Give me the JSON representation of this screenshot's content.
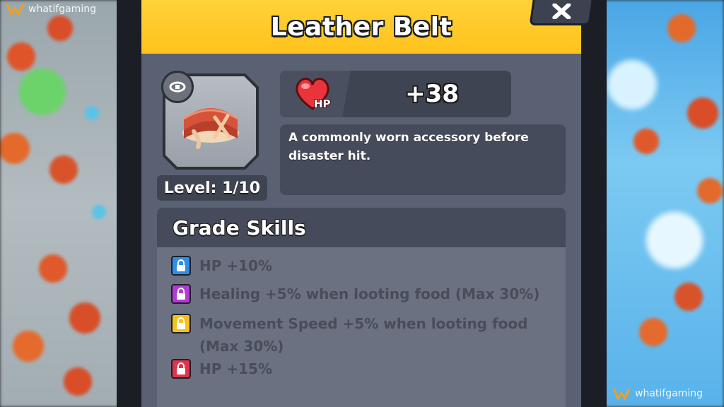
{
  "watermark": "whatifgaming",
  "item": {
    "title": "Leather Belt",
    "level": "Level: 1/10",
    "slot_icon": "belt-slot-icon",
    "image_icon": "leather-belt-icon"
  },
  "stat": {
    "icon": "heart-hp-icon",
    "icon_label": "HP",
    "value": "+38"
  },
  "description": "A commonly worn accessory before disaster hit.",
  "grade_skills": {
    "title": "Grade Skills",
    "items": [
      {
        "text": "HP +10%",
        "color": "#2f8ee8"
      },
      {
        "text": "Healing +5% when looting food (Max 30%)",
        "color": "#b23ad6"
      },
      {
        "text": "Movement Speed +5% when looting food (Max 30%)",
        "color": "#f5c11a"
      },
      {
        "text": "HP +15%",
        "color": "#e0344a"
      }
    ]
  },
  "colors": {
    "title_bar": "#ffc21a",
    "panel": "#5a6172"
  }
}
